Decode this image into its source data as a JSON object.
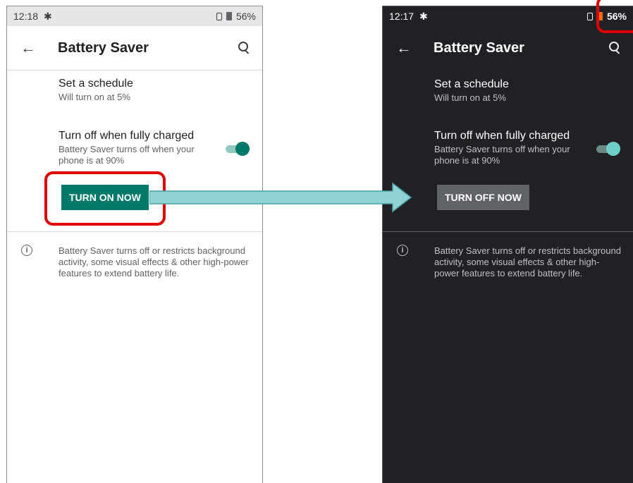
{
  "light_screen": {
    "status": {
      "time": "12:18",
      "battery": "56%"
    },
    "toolbar": {
      "title": "Battery Saver"
    },
    "schedule": {
      "title": "Set a schedule",
      "subtitle": "Will turn on at 5%"
    },
    "fully_charged": {
      "title": "Turn off when fully charged",
      "subtitle": "Battery Saver turns off when your phone is at 90%",
      "toggle_on": true
    },
    "action_button": "TURN ON NOW",
    "footer": "Battery Saver turns off or restricts background activity, some visual effects & other high-power features to extend battery life."
  },
  "dark_screen": {
    "status": {
      "time": "12:17",
      "battery": "56%"
    },
    "toolbar": {
      "title": "Battery Saver"
    },
    "schedule": {
      "title": "Set a schedule",
      "subtitle": "Will turn on at 5%"
    },
    "fully_charged": {
      "title": "Turn off when fully charged",
      "subtitle": "Battery Saver turns off when your phone is at 90%",
      "toggle_on": true
    },
    "action_button": "TURN OFF NOW",
    "footer": "Battery Saver turns off or restricts background activity, some visual effects & other high-power features to extend battery life."
  },
  "colors": {
    "accent_light": "#00796b",
    "highlight": "#e00000",
    "arrow_fill": "#8fd3d6",
    "battery_saver_icon": "#ff6d00"
  },
  "icons": {
    "back": "back-arrow-icon",
    "search": "search-icon",
    "info": "info-icon",
    "settings": "gear-icon"
  }
}
